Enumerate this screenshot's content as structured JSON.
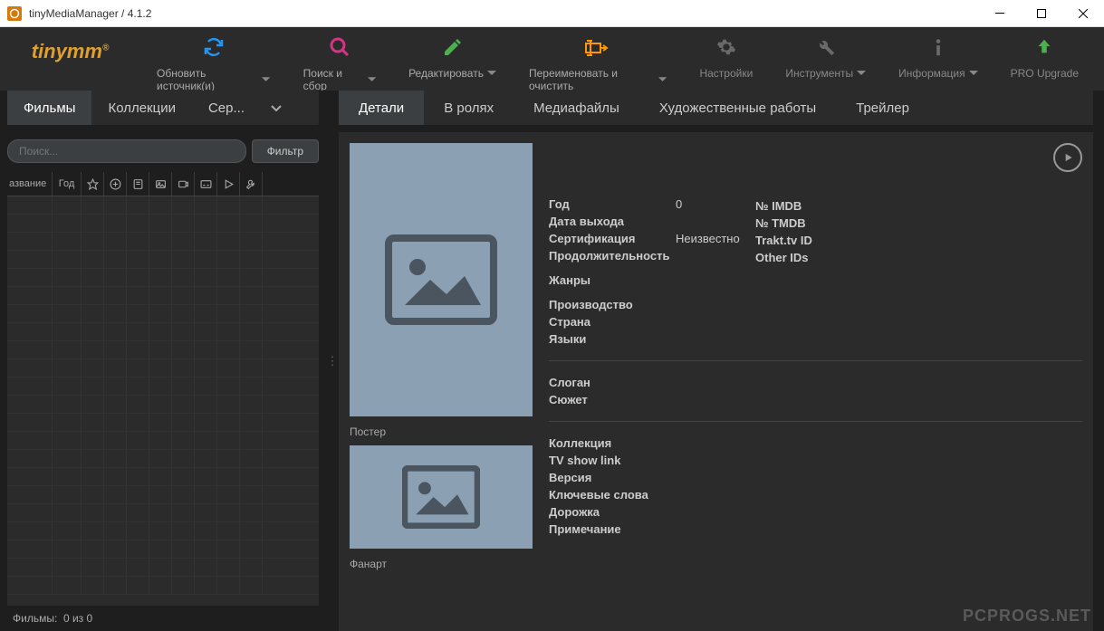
{
  "window": {
    "title": "tinyMediaManager / 4.1.2"
  },
  "logo": {
    "text": "tinymm",
    "reg": "®"
  },
  "toolbar": {
    "main": [
      {
        "label": "Обновить источник(и)",
        "icon": "refresh",
        "color": "#2196f3"
      },
      {
        "label": "Поиск и сбор",
        "icon": "search",
        "color": "#d63384"
      },
      {
        "label": "Редактировать",
        "icon": "edit",
        "color": "#4caf50"
      },
      {
        "label": "Переименовать и очистить",
        "icon": "rename",
        "color": "#ff9800"
      }
    ],
    "right": [
      {
        "label": "Настройки",
        "icon": "settings"
      },
      {
        "label": "Инструменты",
        "icon": "tools",
        "chev": true
      },
      {
        "label": "Информация",
        "icon": "info",
        "chev": true
      },
      {
        "label": "PRO Upgrade",
        "icon": "upgrade",
        "pro": true
      }
    ]
  },
  "leftTabs": [
    "Фильмы",
    "Коллекции",
    "Сер..."
  ],
  "search": {
    "placeholder": "Поиск...",
    "filterBtn": "Фильтр"
  },
  "gridCols": {
    "name": "азвание",
    "year": "Год"
  },
  "leftStatus": {
    "label": "Фильмы:",
    "count": "0  из  0"
  },
  "rightTabs": [
    "Детали",
    "В ролях",
    "Медиафайлы",
    "Художественные работы",
    "Трейлер"
  ],
  "thumbs": {
    "poster": "Постер",
    "fanart": "Фанарт"
  },
  "details": {
    "group1": [
      {
        "k": "Год",
        "v": "0"
      },
      {
        "k": "Дата выхода",
        "v": ""
      },
      {
        "k": "Сертификация",
        "v": "Неизвестно"
      },
      {
        "k": "Продолжительность",
        "v": ""
      }
    ],
    "group_genre": [
      {
        "k": "Жанры",
        "v": ""
      }
    ],
    "group_prod": [
      {
        "k": "Производство",
        "v": ""
      },
      {
        "k": "Страна",
        "v": ""
      },
      {
        "k": "Языки",
        "v": ""
      }
    ],
    "ids": [
      {
        "k": "№ IMDB",
        "v": ""
      },
      {
        "k": "№ TMDB",
        "v": ""
      },
      {
        "k": "Trakt.tv ID",
        "v": ""
      },
      {
        "k": "Other IDs",
        "v": ""
      }
    ],
    "group2": [
      {
        "k": "Слоган",
        "v": ""
      },
      {
        "k": "Сюжет",
        "v": ""
      }
    ],
    "group3": [
      {
        "k": "Коллекция",
        "v": ""
      },
      {
        "k": "TV show link",
        "v": ""
      },
      {
        "k": "Версия",
        "v": ""
      },
      {
        "k": "Ключевые слова",
        "v": ""
      },
      {
        "k": "Дорожка",
        "v": ""
      },
      {
        "k": "Примечание",
        "v": ""
      }
    ]
  },
  "watermark": "PCPROGS.NET"
}
